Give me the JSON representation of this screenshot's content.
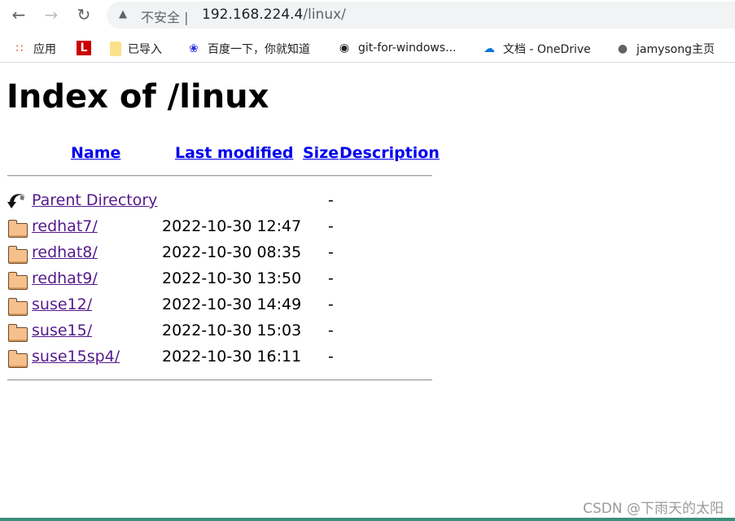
{
  "browser": {
    "back_icon": "arrow-left-icon",
    "forward_icon": "arrow-right-icon",
    "reload_icon": "reload-icon",
    "security_label": "不安全",
    "url_host": "192.168.224.4",
    "url_path": "/linux/",
    "bookmarks": [
      {
        "label": "应用",
        "icon": "apps-grid-icon"
      },
      {
        "label": "",
        "icon": "l-logo-icon"
      },
      {
        "label": "已导入",
        "icon": "folder-icon"
      },
      {
        "label": "百度一下，你就知道",
        "icon": "baidu-paw-icon"
      },
      {
        "label": "git-for-windows...",
        "icon": "git-icon"
      },
      {
        "label": "文档 - OneDrive",
        "icon": "onedrive-cloud-icon"
      },
      {
        "label": "jamysong主页",
        "icon": "globe-icon"
      }
    ]
  },
  "page": {
    "title": "Index of /linux",
    "columns": {
      "name": "Name",
      "last_modified": "Last modified",
      "size": "Size",
      "description": "Description"
    },
    "parent": {
      "name": "Parent Directory",
      "size": "-"
    },
    "entries": [
      {
        "name": "redhat7/",
        "modified": "2022-10-30 12:47",
        "size": "-"
      },
      {
        "name": "redhat8/",
        "modified": "2022-10-30 08:35",
        "size": "-"
      },
      {
        "name": "redhat9/",
        "modified": "2022-10-30 13:50",
        "size": "-"
      },
      {
        "name": "suse12/",
        "modified": "2022-10-30 14:49",
        "size": "-"
      },
      {
        "name": "suse15/",
        "modified": "2022-10-30 15:03",
        "size": "-"
      },
      {
        "name": "suse15sp4/",
        "modified": "2022-10-30 16:11",
        "size": "-"
      }
    ]
  },
  "watermark": "CSDN @下雨天的太阳"
}
